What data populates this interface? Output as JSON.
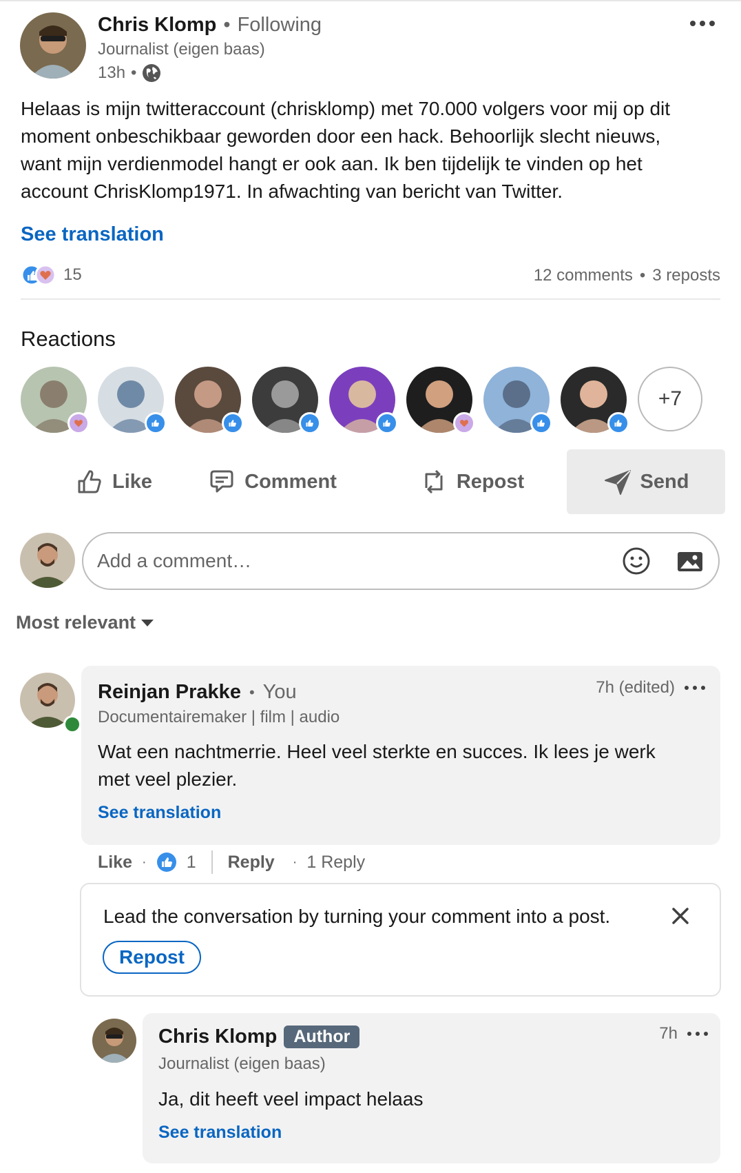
{
  "post": {
    "author_name": "Chris Klomp",
    "follow_status": "Following",
    "headline": "Journalist (eigen baas)",
    "time": "13h",
    "lines": [
      "Helaas is mijn twitteraccount (chrisklomp) met 70.000 volgers voor mij op dit",
      "moment onbeschikbaar geworden door een hack. Behoorlijk slecht nieuws,",
      "want mijn verdienmodel hangt er ook aan. Ik ben tijdelijk te vinden op het",
      "account ChrisKlomp1971. In afwachting van bericht van Twitter."
    ],
    "see_translation": "See translation",
    "reaction_count": "15",
    "comments_count": "12 comments",
    "reposts_count": "3 reposts"
  },
  "reactions": {
    "heading": "Reactions",
    "more": "+7",
    "people": [
      {
        "badge": "love",
        "face": "#8a7f6e",
        "bg": "#b7c4b0"
      },
      {
        "badge": "like",
        "face": "#6f8aa6",
        "bg": "#d6dde3"
      },
      {
        "badge": "like",
        "face": "#c49a84",
        "bg": "#5a4a3d"
      },
      {
        "badge": "like",
        "face": "#9a9a9a",
        "bg": "#3c3c3c"
      },
      {
        "badge": "like",
        "face": "#d9b8a0",
        "bg": "#7b3fbe"
      },
      {
        "badge": "love",
        "face": "#d1a07f",
        "bg": "#1e1e1e"
      },
      {
        "badge": "like",
        "face": "#5b6f8a",
        "bg": "#8fb3d9"
      },
      {
        "badge": "like",
        "face": "#e0b49a",
        "bg": "#2a2a2a"
      }
    ]
  },
  "actions": {
    "like": "Like",
    "comment": "Comment",
    "repost": "Repost",
    "send": "Send"
  },
  "composer": {
    "placeholder": "Add a comment…"
  },
  "sort": {
    "label": "Most relevant"
  },
  "comment1": {
    "author": "Reinjan Prakke",
    "you": "You",
    "headline": "Documentairemaker | film | audio",
    "time": "7h (edited)",
    "lines": [
      "Wat een nachtmerrie. Heel veel sterkte en succes. Ik lees je werk",
      "met veel plezier."
    ],
    "see_translation": "See translation",
    "like": "Like",
    "like_count": "1",
    "reply": "Reply",
    "replies": "1 Reply"
  },
  "prompt": {
    "text": "Lead the conversation by turning your comment into a post.",
    "button": "Repost"
  },
  "reply1": {
    "author": "Chris Klomp",
    "badge": "Author",
    "headline": "Journalist (eigen baas)",
    "time": "7h",
    "text": "Ja, dit heeft veel impact helaas",
    "see_translation": "See translation"
  }
}
